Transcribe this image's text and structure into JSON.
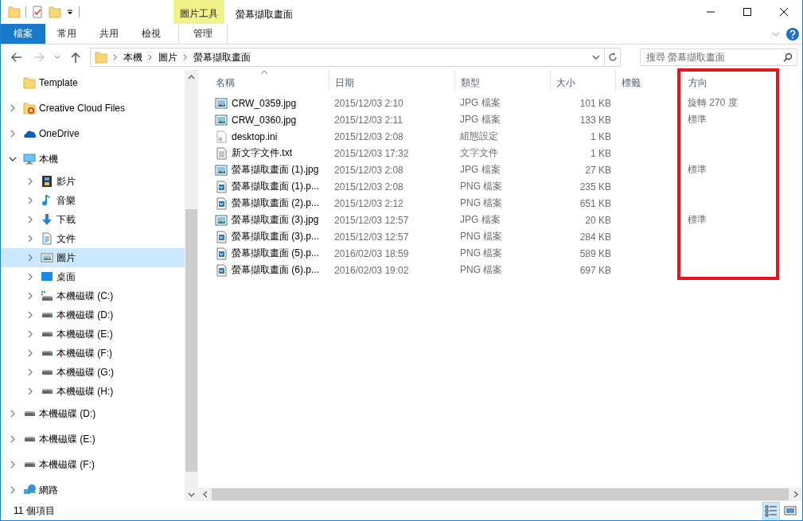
{
  "window": {
    "title": "螢幕擷取畫面",
    "context_group": "圖片工具"
  },
  "ribbon_tabs": [
    {
      "label": "檔案",
      "kind": "file"
    },
    {
      "label": "常用",
      "kind": "normal"
    },
    {
      "label": "共用",
      "kind": "normal"
    },
    {
      "label": "檢視",
      "kind": "normal"
    },
    {
      "label": "管理",
      "kind": "context"
    }
  ],
  "address_bar": {
    "back_enabled": true,
    "forward_enabled": false,
    "crumbs": [
      "本機",
      "圖片",
      "螢幕擷取畫面"
    ]
  },
  "search": {
    "placeholder": "搜尋 螢幕擷取畫面"
  },
  "navigation": [
    {
      "label": "Template",
      "kind": "folder",
      "expandable": false,
      "selected": false
    },
    {
      "label": "Creative Cloud Files",
      "kind": "cc-folder",
      "expandable": true,
      "expanded": false,
      "selected": false
    },
    {
      "label": "OneDrive",
      "kind": "cloud",
      "expandable": true,
      "expanded": false,
      "selected": false
    },
    {
      "label": "本機",
      "kind": "pc",
      "expandable": true,
      "expanded": true,
      "selected": false,
      "children": [
        {
          "label": "影片",
          "kind": "video",
          "expandable": true,
          "expanded": false,
          "selected": false
        },
        {
          "label": "音樂",
          "kind": "music",
          "expandable": true,
          "expanded": false,
          "selected": false
        },
        {
          "label": "下載",
          "kind": "download",
          "expandable": true,
          "expanded": false,
          "selected": false
        },
        {
          "label": "文件",
          "kind": "document",
          "expandable": true,
          "expanded": false,
          "selected": false
        },
        {
          "label": "圖片",
          "kind": "pictures",
          "expandable": true,
          "expanded": false,
          "selected": true
        },
        {
          "label": "桌面",
          "kind": "desktop",
          "expandable": true,
          "expanded": false,
          "selected": false
        },
        {
          "label": "本機磁碟 (C:)",
          "kind": "drive-os",
          "expandable": true,
          "expanded": false,
          "selected": false
        },
        {
          "label": "本機磁碟 (D:)",
          "kind": "drive",
          "expandable": true,
          "expanded": false,
          "selected": false
        },
        {
          "label": "本機磁碟 (E:)",
          "kind": "drive",
          "expandable": true,
          "expanded": false,
          "selected": false
        },
        {
          "label": "本機磁碟 (F:)",
          "kind": "drive",
          "expandable": true,
          "expanded": false,
          "selected": false
        },
        {
          "label": "本機磁碟 (G:)",
          "kind": "drive",
          "expandable": true,
          "expanded": false,
          "selected": false
        },
        {
          "label": "本機磁碟 (H:)",
          "kind": "drive",
          "expandable": true,
          "expanded": false,
          "selected": false
        }
      ]
    },
    {
      "label": "本機磁碟 (D:)",
      "kind": "drive",
      "expandable": true,
      "expanded": false,
      "selected": false
    },
    {
      "label": "本機磁碟 (E:)",
      "kind": "drive",
      "expandable": true,
      "expanded": false,
      "selected": false
    },
    {
      "label": "本機磁碟 (F:)",
      "kind": "drive",
      "expandable": true,
      "expanded": false,
      "selected": false
    },
    {
      "label": "網路",
      "kind": "network",
      "expandable": true,
      "expanded": false,
      "selected": false
    }
  ],
  "file_list": {
    "columns": [
      {
        "label": "名稱",
        "sorted": true
      },
      {
        "label": "日期",
        "sorted": false
      },
      {
        "label": "類型",
        "sorted": false
      },
      {
        "label": "大小",
        "sorted": false
      },
      {
        "label": "標籤",
        "sorted": false
      },
      {
        "label": "方向",
        "sorted": false
      }
    ],
    "rows": [
      {
        "kind": "photo",
        "cells": [
          "CRW_0359.jpg",
          "2015/12/03 2:10",
          "JPG 檔案",
          "101 KB",
          "",
          "旋轉 270 度"
        ]
      },
      {
        "kind": "photo",
        "cells": [
          "CRW_0360.jpg",
          "2015/12/03 2:11",
          "JPG 檔案",
          "133 KB",
          "",
          "標準"
        ]
      },
      {
        "kind": "settings-file",
        "cells": [
          "desktop.ini",
          "2015/12/03 2:08",
          "組態設定",
          "1 KB",
          "",
          ""
        ]
      },
      {
        "kind": "text",
        "cells": [
          "新文字文件.txt",
          "2015/12/03 17:32",
          "文字文件",
          "1 KB",
          "",
          ""
        ]
      },
      {
        "kind": "photo",
        "cells": [
          "螢幕擷取畫面 (1).jpg",
          "2015/12/03 2:08",
          "JPG 檔案",
          "27 KB",
          "",
          "標準"
        ]
      },
      {
        "kind": "png",
        "cells": [
          "螢幕擷取畫面 (1).p...",
          "2015/12/03 2:08",
          "PNG 檔案",
          "235 KB",
          "",
          ""
        ]
      },
      {
        "kind": "png",
        "cells": [
          "螢幕擷取畫面 (2).p...",
          "2015/12/03 2:12",
          "PNG 檔案",
          "651 KB",
          "",
          ""
        ]
      },
      {
        "kind": "photo",
        "cells": [
          "螢幕擷取畫面 (3).jpg",
          "2015/12/03 12:57",
          "JPG 檔案",
          "20 KB",
          "",
          "標準"
        ]
      },
      {
        "kind": "png",
        "cells": [
          "螢幕擷取畫面 (3).p...",
          "2015/12/03 12:57",
          "PNG 檔案",
          "284 KB",
          "",
          ""
        ]
      },
      {
        "kind": "png",
        "cells": [
          "螢幕擷取畫面 (5).p...",
          "2016/02/03 18:59",
          "PNG 檔案",
          "589 KB",
          "",
          ""
        ]
      },
      {
        "kind": "png",
        "cells": [
          "螢幕擷取畫面 (6).p...",
          "2016/02/03 19:02",
          "PNG 檔案",
          "697 KB",
          "",
          ""
        ]
      }
    ]
  },
  "annotation": {
    "kind": "box",
    "color": "#e3141e"
  },
  "status_bar": {
    "count": "11 個項目",
    "views": [
      {
        "kind": "details",
        "selected": true
      },
      {
        "kind": "large-icons",
        "selected": false
      }
    ]
  }
}
